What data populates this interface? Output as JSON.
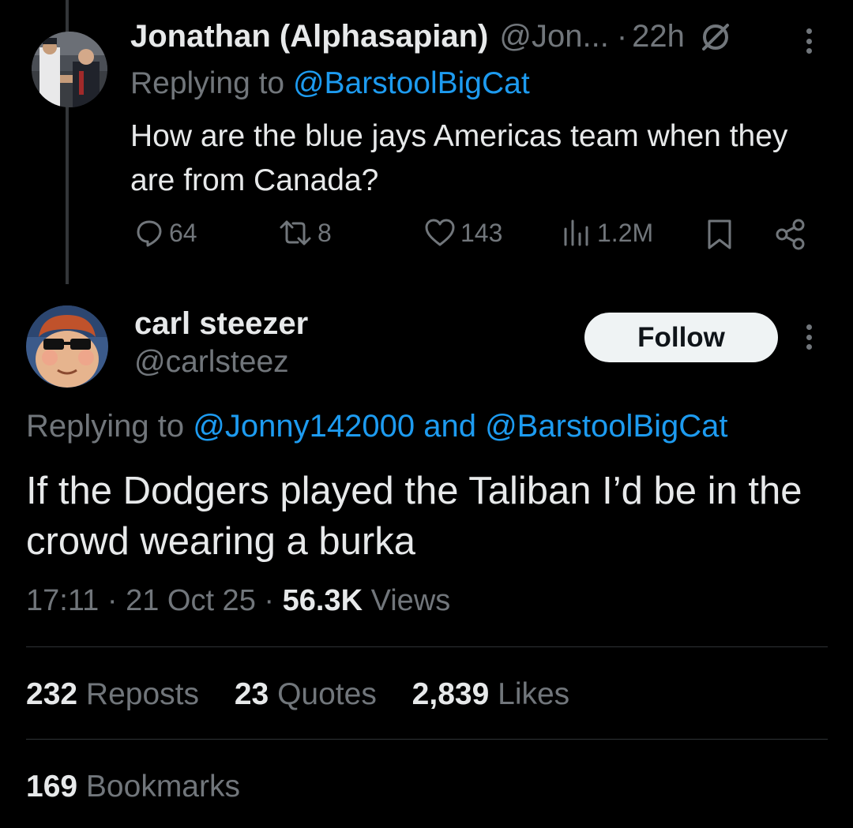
{
  "parent_tweet": {
    "display_name": "Jonathan (Alphasapian)",
    "handle": "@Jon...",
    "separator": "·",
    "time": "22h",
    "replying_prefix": "Replying to",
    "replying_to": "@BarstoolBigCat",
    "text": "How are the blue jays Americas team when they are from Canada?",
    "replies": "64",
    "reposts": "8",
    "likes": "143",
    "views": "1.2M"
  },
  "main_tweet": {
    "display_name": "carl steezer",
    "handle": "@carlsteez",
    "follow_label": "Follow",
    "replying_prefix": "Replying to",
    "replying_to_1": "@Jonny142000",
    "replying_and": "and",
    "replying_to_2": "@BarstoolBigCat",
    "text": "If the Dodgers played the Taliban I’d be in the crowd wearing a burka",
    "time": "17:11",
    "date": "21 Oct 25",
    "sep": "·",
    "views_count": "56.3K",
    "views_label": "Views",
    "reposts_count": "232",
    "reposts_label": "Reposts",
    "quotes_count": "23",
    "quotes_label": "Quotes",
    "likes_count": "2,839",
    "likes_label": "Likes",
    "bookmarks_count": "169",
    "bookmarks_label": "Bookmarks"
  },
  "colors": {
    "background": "#000000",
    "text": "#e7e9ea",
    "muted": "#71767b",
    "link": "#1d9bf0",
    "divider": "#2f3336",
    "follow_bg": "#eff3f4"
  }
}
